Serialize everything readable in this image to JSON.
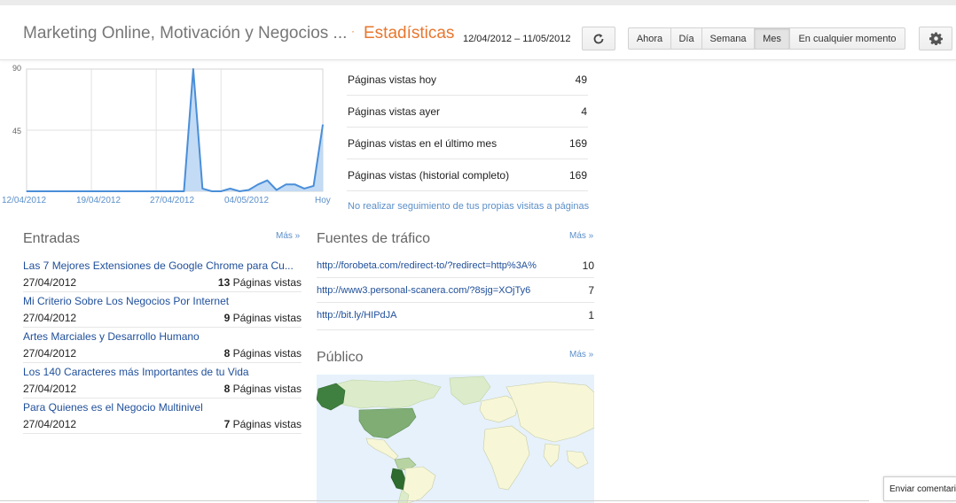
{
  "header": {
    "blog_title": "Marketing Online, Motivación y Negocios ...",
    "separator": "·",
    "page_title": "Estadísticas",
    "date_range": "12/04/2012 – 11/05/2012",
    "refresh_icon": "refresh-icon",
    "ranges": [
      "Ahora",
      "Día",
      "Semana",
      "Mes",
      "En cualquier momento"
    ],
    "active_range": "Mes",
    "settings_icon": "gear-icon"
  },
  "chart_data": {
    "type": "area",
    "y_ticks": [
      "90",
      "45"
    ],
    "ylim": [
      0,
      90
    ],
    "x_ticks": [
      "12/04/2012",
      "19/04/2012",
      "27/04/2012",
      "04/05/2012",
      "Hoy"
    ],
    "values": [
      0,
      0,
      0,
      0,
      0,
      0,
      0,
      0,
      0,
      0,
      0,
      0,
      0,
      0,
      0,
      0,
      0,
      0,
      90,
      2,
      0,
      0,
      2,
      0,
      1,
      5,
      8,
      1,
      5,
      5,
      2,
      4,
      49
    ],
    "color": "#4a8ed8",
    "fill": "#b9d5f3",
    "grid": true
  },
  "stats": [
    {
      "label": "Páginas vistas hoy",
      "value": "49"
    },
    {
      "label": "Páginas vistas ayer",
      "value": "4"
    },
    {
      "label": "Páginas vistas en el último mes",
      "value": "169"
    },
    {
      "label": "Páginas vistas (historial completo)",
      "value": "169"
    }
  ],
  "no_track_link": "No realizar seguimiento de tus propias visitas a páginas",
  "entradas": {
    "heading": "Entradas",
    "more": "Más »",
    "suffix": " Páginas vistas",
    "posts": [
      {
        "title": "Las 7 Mejores Extensiones de Google Chrome para Cu...",
        "date": "27/04/2012",
        "views": "13"
      },
      {
        "title": "Mi Criterio Sobre Los Negocios Por Internet",
        "date": "27/04/2012",
        "views": "9"
      },
      {
        "title": "Artes Marciales y Desarrollo Humano",
        "date": "27/04/2012",
        "views": "8"
      },
      {
        "title": "Los 140 Caracteres más Importantes de tu Vida",
        "date": "27/04/2012",
        "views": "8"
      },
      {
        "title": "Para Quienes es el Negocio Multinivel",
        "date": "27/04/2012",
        "views": "7"
      }
    ]
  },
  "fuentes": {
    "heading": "Fuentes de tráfico",
    "more": "Más »",
    "sources": [
      {
        "url": "http://forobeta.com/redirect-to/?redirect=http%3A%",
        "value": "10"
      },
      {
        "url": "http://www3.personal-scanera.com/?8sjg=XOjTy6",
        "value": "7"
      },
      {
        "url": "http://bit.ly/HIPdJA",
        "value": "1"
      }
    ]
  },
  "publico": {
    "heading": "Público",
    "more": "Más »"
  },
  "feedback": "Enviar comentarios"
}
